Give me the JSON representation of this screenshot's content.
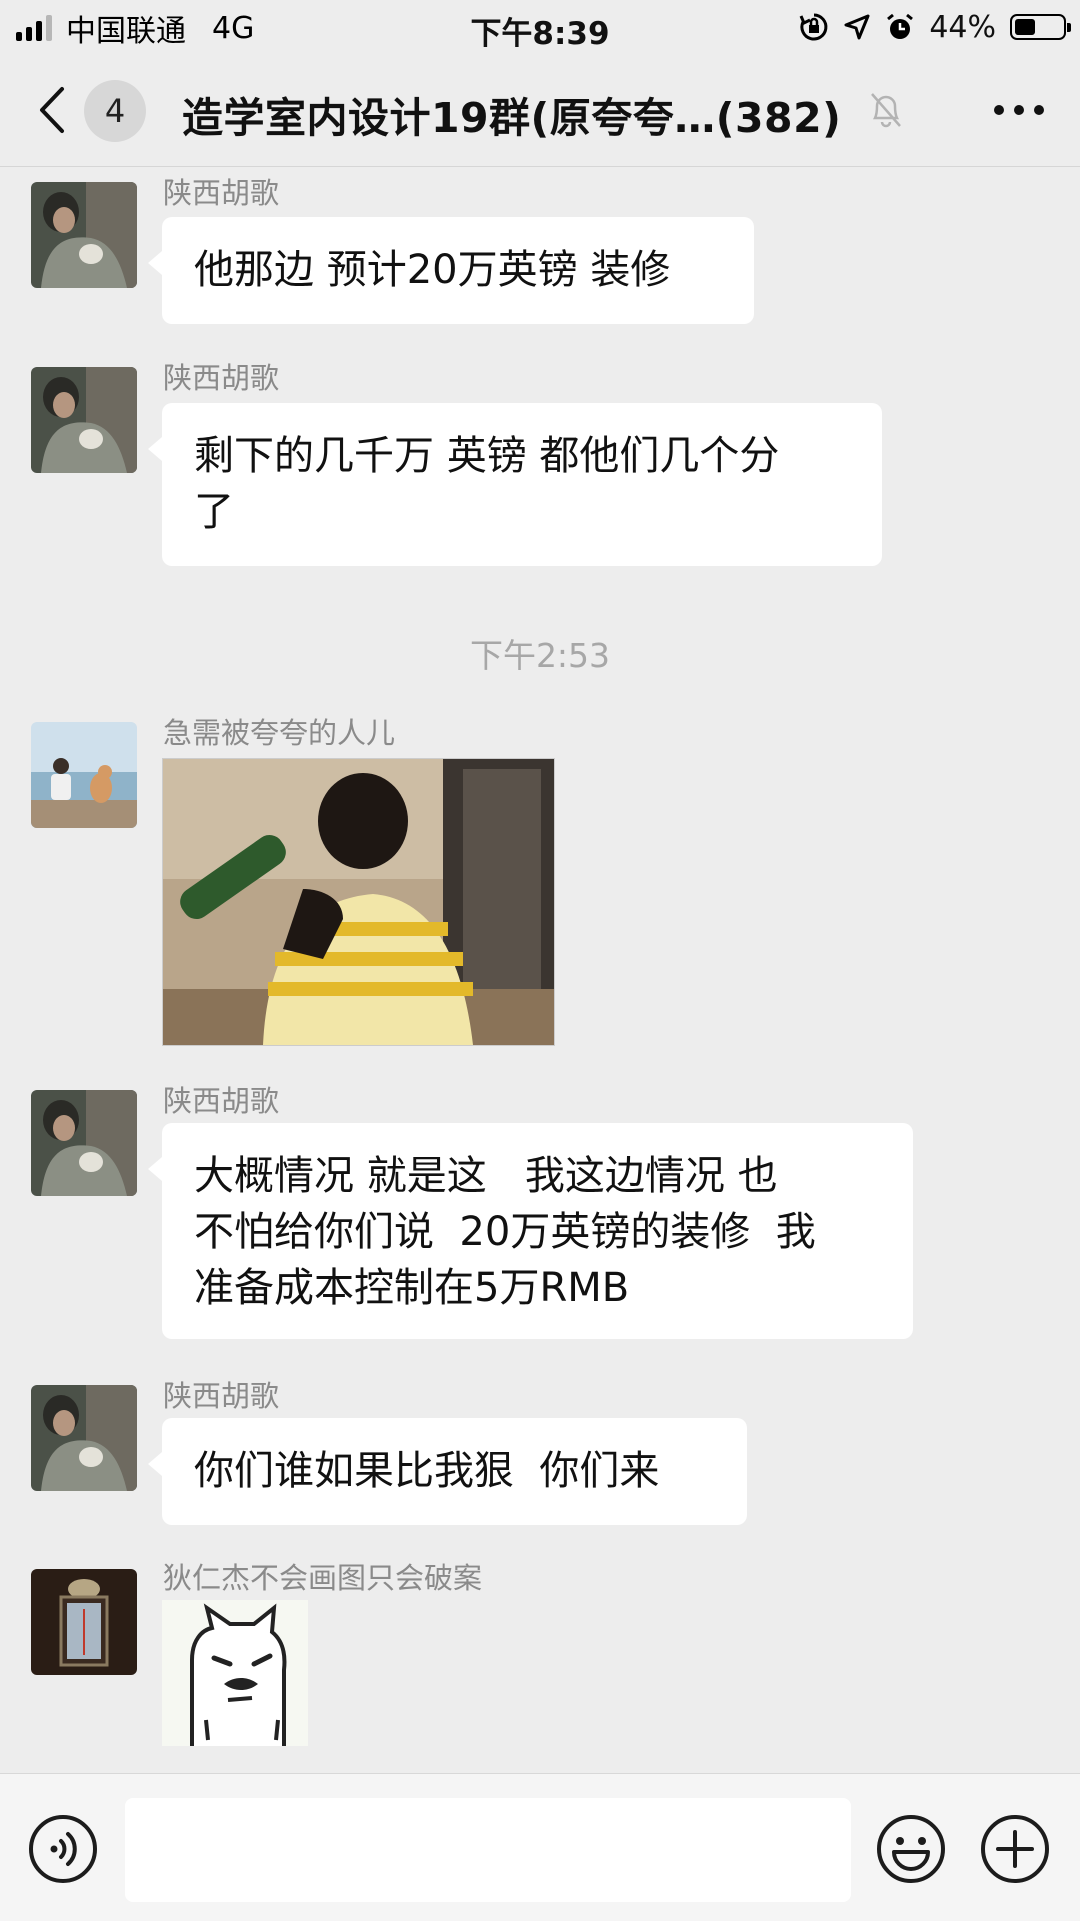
{
  "status": {
    "carrier": "中国联通",
    "network": "4G",
    "time": "下午8:39",
    "battery": "44%",
    "battery_level": 0.44
  },
  "header": {
    "badge": "4",
    "title": "造学室内设计19群(原夸夸…(382)"
  },
  "messages": [
    {
      "sender": "陕西胡歌",
      "text": "他那边 预计20万英镑 装修"
    },
    {
      "sender": "陕西胡歌",
      "text": "剩下的几千万 英镑 都他们几个分\n了"
    },
    {
      "sender": "急需被夸夸的人儿"
    },
    {
      "sender": "陕西胡歌",
      "text": "大概情况 就是这   我这边情况 也\n不怕给你们说  20万英镑的装修  我\n准备成本控制在5万RMB"
    },
    {
      "sender": "陕西胡歌",
      "text": "你们谁如果比我狠  你们来"
    },
    {
      "sender": "狄仁杰不会画图只会破案"
    }
  ],
  "timestamp": "下午2:53",
  "icons": {
    "back": "chevron-left-icon",
    "mute": "bell-slash-icon",
    "more": "ellipsis-icon",
    "voice": "voice-icon",
    "emoji": "smiley-icon",
    "plus": "plus-circle-icon"
  }
}
